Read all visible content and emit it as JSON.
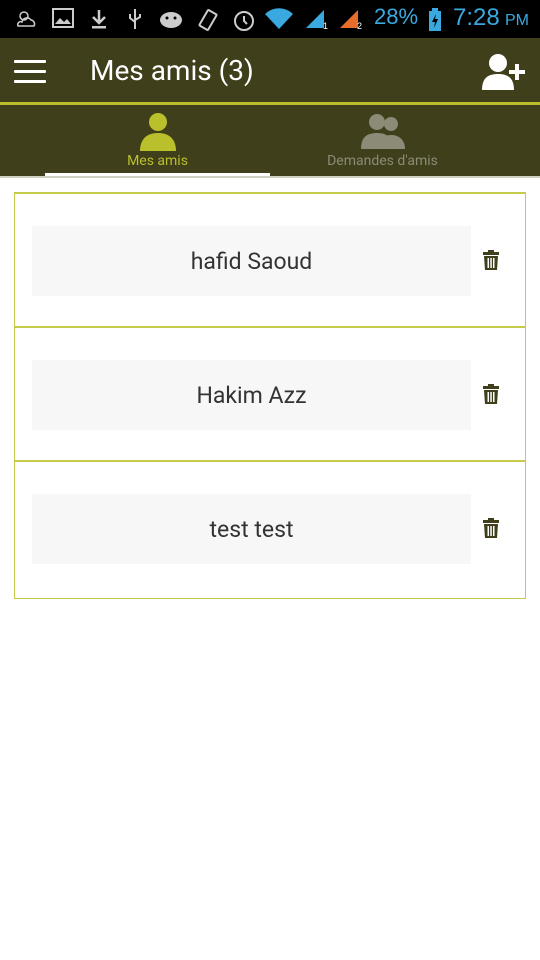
{
  "status_bar": {
    "battery": "28%",
    "time": "7:28",
    "ampm": "PM",
    "icons": [
      "weather-icon",
      "gallery-icon",
      "download-icon",
      "usb-icon",
      "android-icon",
      "vibrate-icon",
      "alarm-icon",
      "wifi-icon",
      "signal-sim1-icon",
      "signal-sim2-icon",
      "battery-icon"
    ]
  },
  "action_bar": {
    "title": "Mes amis (3)",
    "menu_icon": "hamburger-menu-icon",
    "add_friend_icon": "add-user-icon"
  },
  "tabs": [
    {
      "label": "Mes amis",
      "icon": "person-icon",
      "selected": true
    },
    {
      "label": "Demandes d'amis",
      "icon": "people-icon",
      "selected": false
    }
  ],
  "friends": [
    {
      "name": "hafid Saoud"
    },
    {
      "name": "Hakim Azz"
    },
    {
      "name": "test test"
    }
  ],
  "colors": {
    "bar": "#3f3f1b",
    "accent": "#b9c02b",
    "status": "#3aa9e0"
  }
}
